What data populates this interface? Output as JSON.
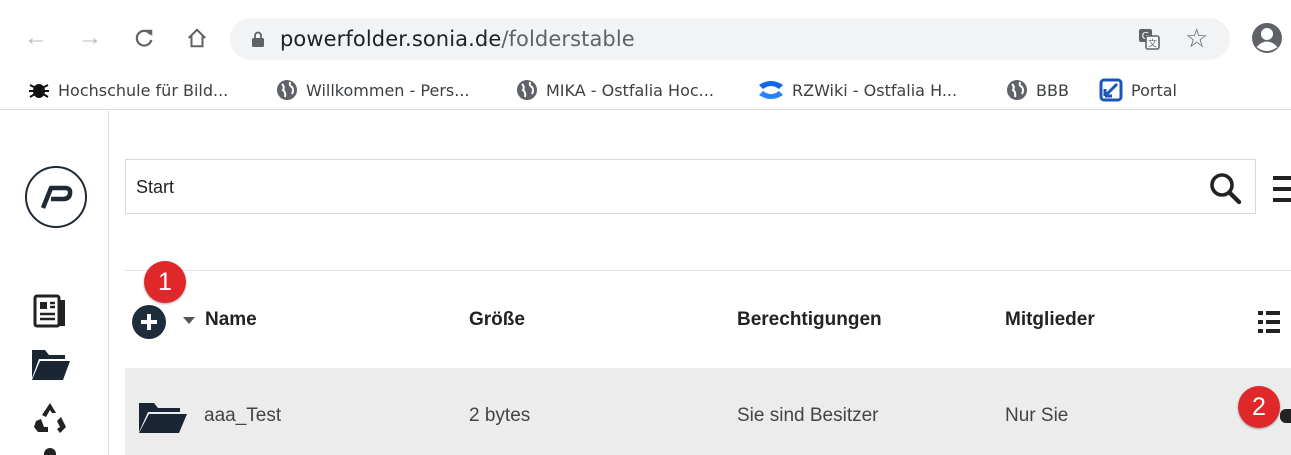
{
  "browser": {
    "url_host": "powerfolder.sonia.de",
    "url_path": "/folderstable",
    "bookmarks": [
      {
        "label": "Hochschule für Bild...",
        "icon": "bug-icon"
      },
      {
        "label": "Willkommen - Pers...",
        "icon": "globe-icon"
      },
      {
        "label": "MIKA - Ostfalia Hoc...",
        "icon": "globe-icon"
      },
      {
        "label": "RZWiki - Ostfalia H...",
        "icon": "confluence-icon"
      },
      {
        "label": "BBB",
        "icon": "globe-icon"
      },
      {
        "label": "Portal",
        "icon": "portal-icon"
      }
    ]
  },
  "search": {
    "value": "Start"
  },
  "table": {
    "headers": {
      "name": "Name",
      "size": "Größe",
      "permissions": "Berechtigungen",
      "members": "Mitglieder"
    },
    "rows": [
      {
        "name": "aaa_Test",
        "size": "2 bytes",
        "permissions": "Sie sind Besitzer",
        "members": "Nur Sie"
      }
    ]
  },
  "annotations": {
    "badge1": "1",
    "badge2": "2"
  },
  "colors": {
    "accent_dark": "#1e2d3b",
    "badge_red": "#e0282b",
    "row_bg": "#ececec"
  }
}
